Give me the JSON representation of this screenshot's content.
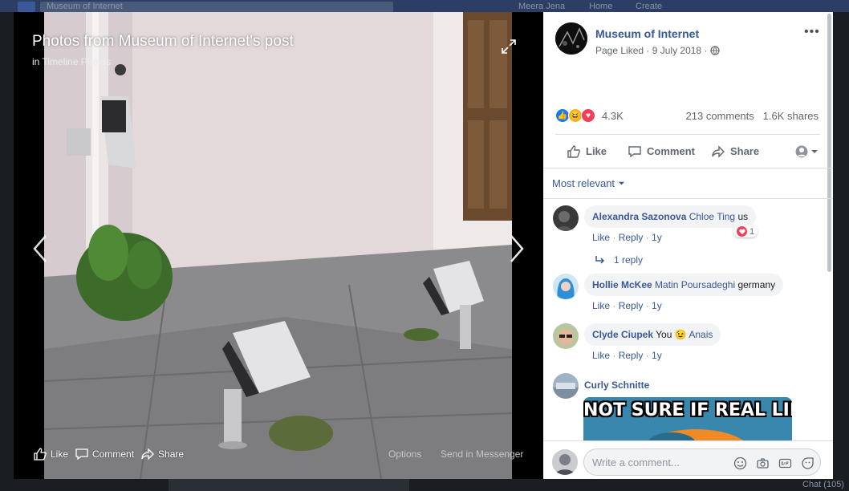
{
  "background": {
    "search_value": "Museum of Internet",
    "nav_items": [
      "Meera Jena",
      "Home",
      "Create"
    ],
    "chat_label": "Chat (105)"
  },
  "viewer": {
    "title": "Photos from Museum of Internet's post",
    "subtitle_prefix": "in",
    "album_link": "Timeline Photos",
    "actions": {
      "like": "Like",
      "comment": "Comment",
      "share": "Share",
      "options": "Options",
      "send": "Send in Messenger"
    }
  },
  "post": {
    "page_name": "Museum of Internet",
    "liked_label": "Page Liked",
    "date": "9 July 2018",
    "reaction_count": "4.3K",
    "comments_count": "213 comments",
    "shares_count": "1.6K shares",
    "actions": {
      "like": "Like",
      "comment": "Comment",
      "share": "Share"
    },
    "sort_label": "Most relevant"
  },
  "comments": [
    {
      "author": "Alexandra Sazonova",
      "tag": "Chloe Ting",
      "text": "us",
      "like": "Like",
      "reply": "Reply",
      "age": "1y",
      "reaction_count": "1",
      "replies_label": "1 reply"
    },
    {
      "author": "Hollie McKee",
      "tag": "Matin Poursadeghi",
      "text": "germany",
      "like": "Like",
      "reply": "Reply",
      "age": "1y"
    },
    {
      "author": "Clyde Ciupek",
      "text_before": "You",
      "emoji": "😉",
      "tag": "Anais",
      "like": "Like",
      "reply": "Reply",
      "age": "1y"
    },
    {
      "author": "Curly Schnitte",
      "meme_text": "NOT SURE IF REAL LIFE"
    }
  ],
  "composer": {
    "placeholder": "Write a comment..."
  },
  "colors": {
    "link": "#385898",
    "like_blue": "#1877f2",
    "heart_red": "#f33e58",
    "haha_yellow": "#f7b125"
  }
}
